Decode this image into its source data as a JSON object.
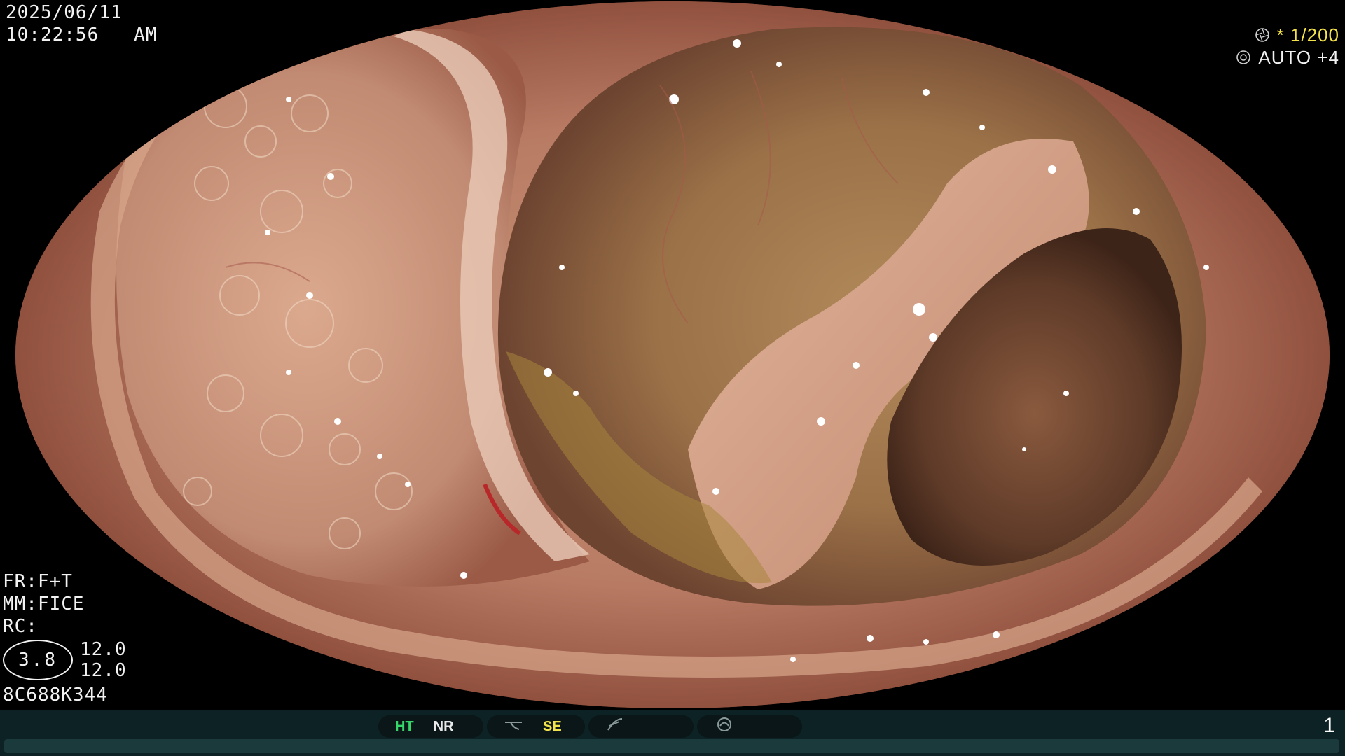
{
  "datetime": {
    "date": "2025/06/11",
    "time": "10:22:56   AM"
  },
  "exposure": {
    "shutter_prefix": "*",
    "shutter": "1/200",
    "mode": "AUTO +4",
    "icons": [
      "aperture-icon",
      "iris-icon"
    ]
  },
  "settings": {
    "fr": "FR:F+T",
    "mm": "MM:FICE",
    "rc": "RC:",
    "zoom": "3.8",
    "zoom_values": [
      "12.0",
      "12.0"
    ],
    "serial": "8C688K344"
  },
  "status_bar": {
    "ht": "HT",
    "nr": "NR",
    "se": "SE",
    "page": "1",
    "colors": {
      "ht": "#37d66a",
      "se": "#f2e34a",
      "bar": "#0d2224"
    }
  }
}
